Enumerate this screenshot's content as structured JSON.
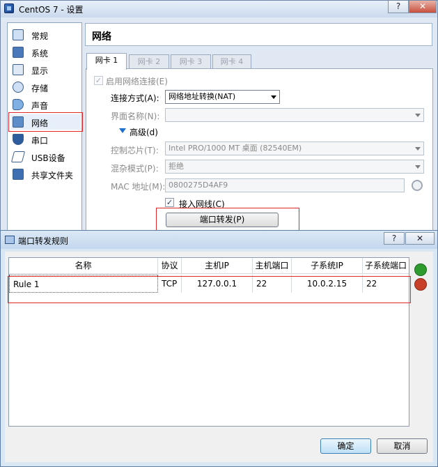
{
  "settings_window": {
    "title": "CentOS 7 - 设置",
    "help_button": "?",
    "close_button": "✕",
    "sidebar": {
      "items": [
        {
          "label": "常规",
          "icon": "general-icon"
        },
        {
          "label": "系统",
          "icon": "system-icon"
        },
        {
          "label": "显示",
          "icon": "display-icon"
        },
        {
          "label": "存储",
          "icon": "storage-icon"
        },
        {
          "label": "声音",
          "icon": "audio-icon"
        },
        {
          "label": "网络",
          "icon": "network-icon",
          "selected": true
        },
        {
          "label": "串口",
          "icon": "serial-port-icon"
        },
        {
          "label": "USB设备",
          "icon": "usb-icon"
        },
        {
          "label": "共享文件夹",
          "icon": "shared-folder-icon"
        }
      ]
    },
    "section_title": "网络",
    "tabs": [
      "网卡 1",
      "网卡 2",
      "网卡 3",
      "网卡 4"
    ],
    "network": {
      "enable_label": "启用网络连接(E)",
      "enable_checked": true,
      "attached_to_label": "连接方式(A):",
      "attached_to_value": "网络地址转换(NAT)",
      "name_label": "界面名称(N):",
      "name_value": "",
      "advanced_label": "高级(d)",
      "adapter_type_label": "控制芯片(T):",
      "adapter_type_value": "Intel PRO/1000 MT 桌面 (82540EM)",
      "promiscuous_label": "混杂模式(P):",
      "promiscuous_value": "拒绝",
      "mac_label": "MAC 地址(M):",
      "mac_value": "0800275D4AF9",
      "cable_connected_label": "接入网线(C)",
      "cable_connected_checked": true,
      "port_forwarding_button": "端口转发(P)"
    }
  },
  "port_forward_window": {
    "title": "端口转发规则",
    "help_button": "?",
    "close_button": "✕",
    "columns": [
      "名称",
      "协议",
      "主机IP",
      "主机端口",
      "子系统IP",
      "子系统端口"
    ],
    "rows": [
      {
        "name": "Rule 1",
        "protocol": "TCP",
        "host_ip": "127.0.0.1",
        "host_port": "22",
        "guest_ip": "10.0.2.15",
        "guest_port": "22"
      }
    ],
    "ok_button": "确定",
    "cancel_button": "取消"
  },
  "colors": {
    "highlight_box": "#e0282c",
    "add_rule": "#2e9b2e",
    "remove_rule": "#c8402a"
  }
}
